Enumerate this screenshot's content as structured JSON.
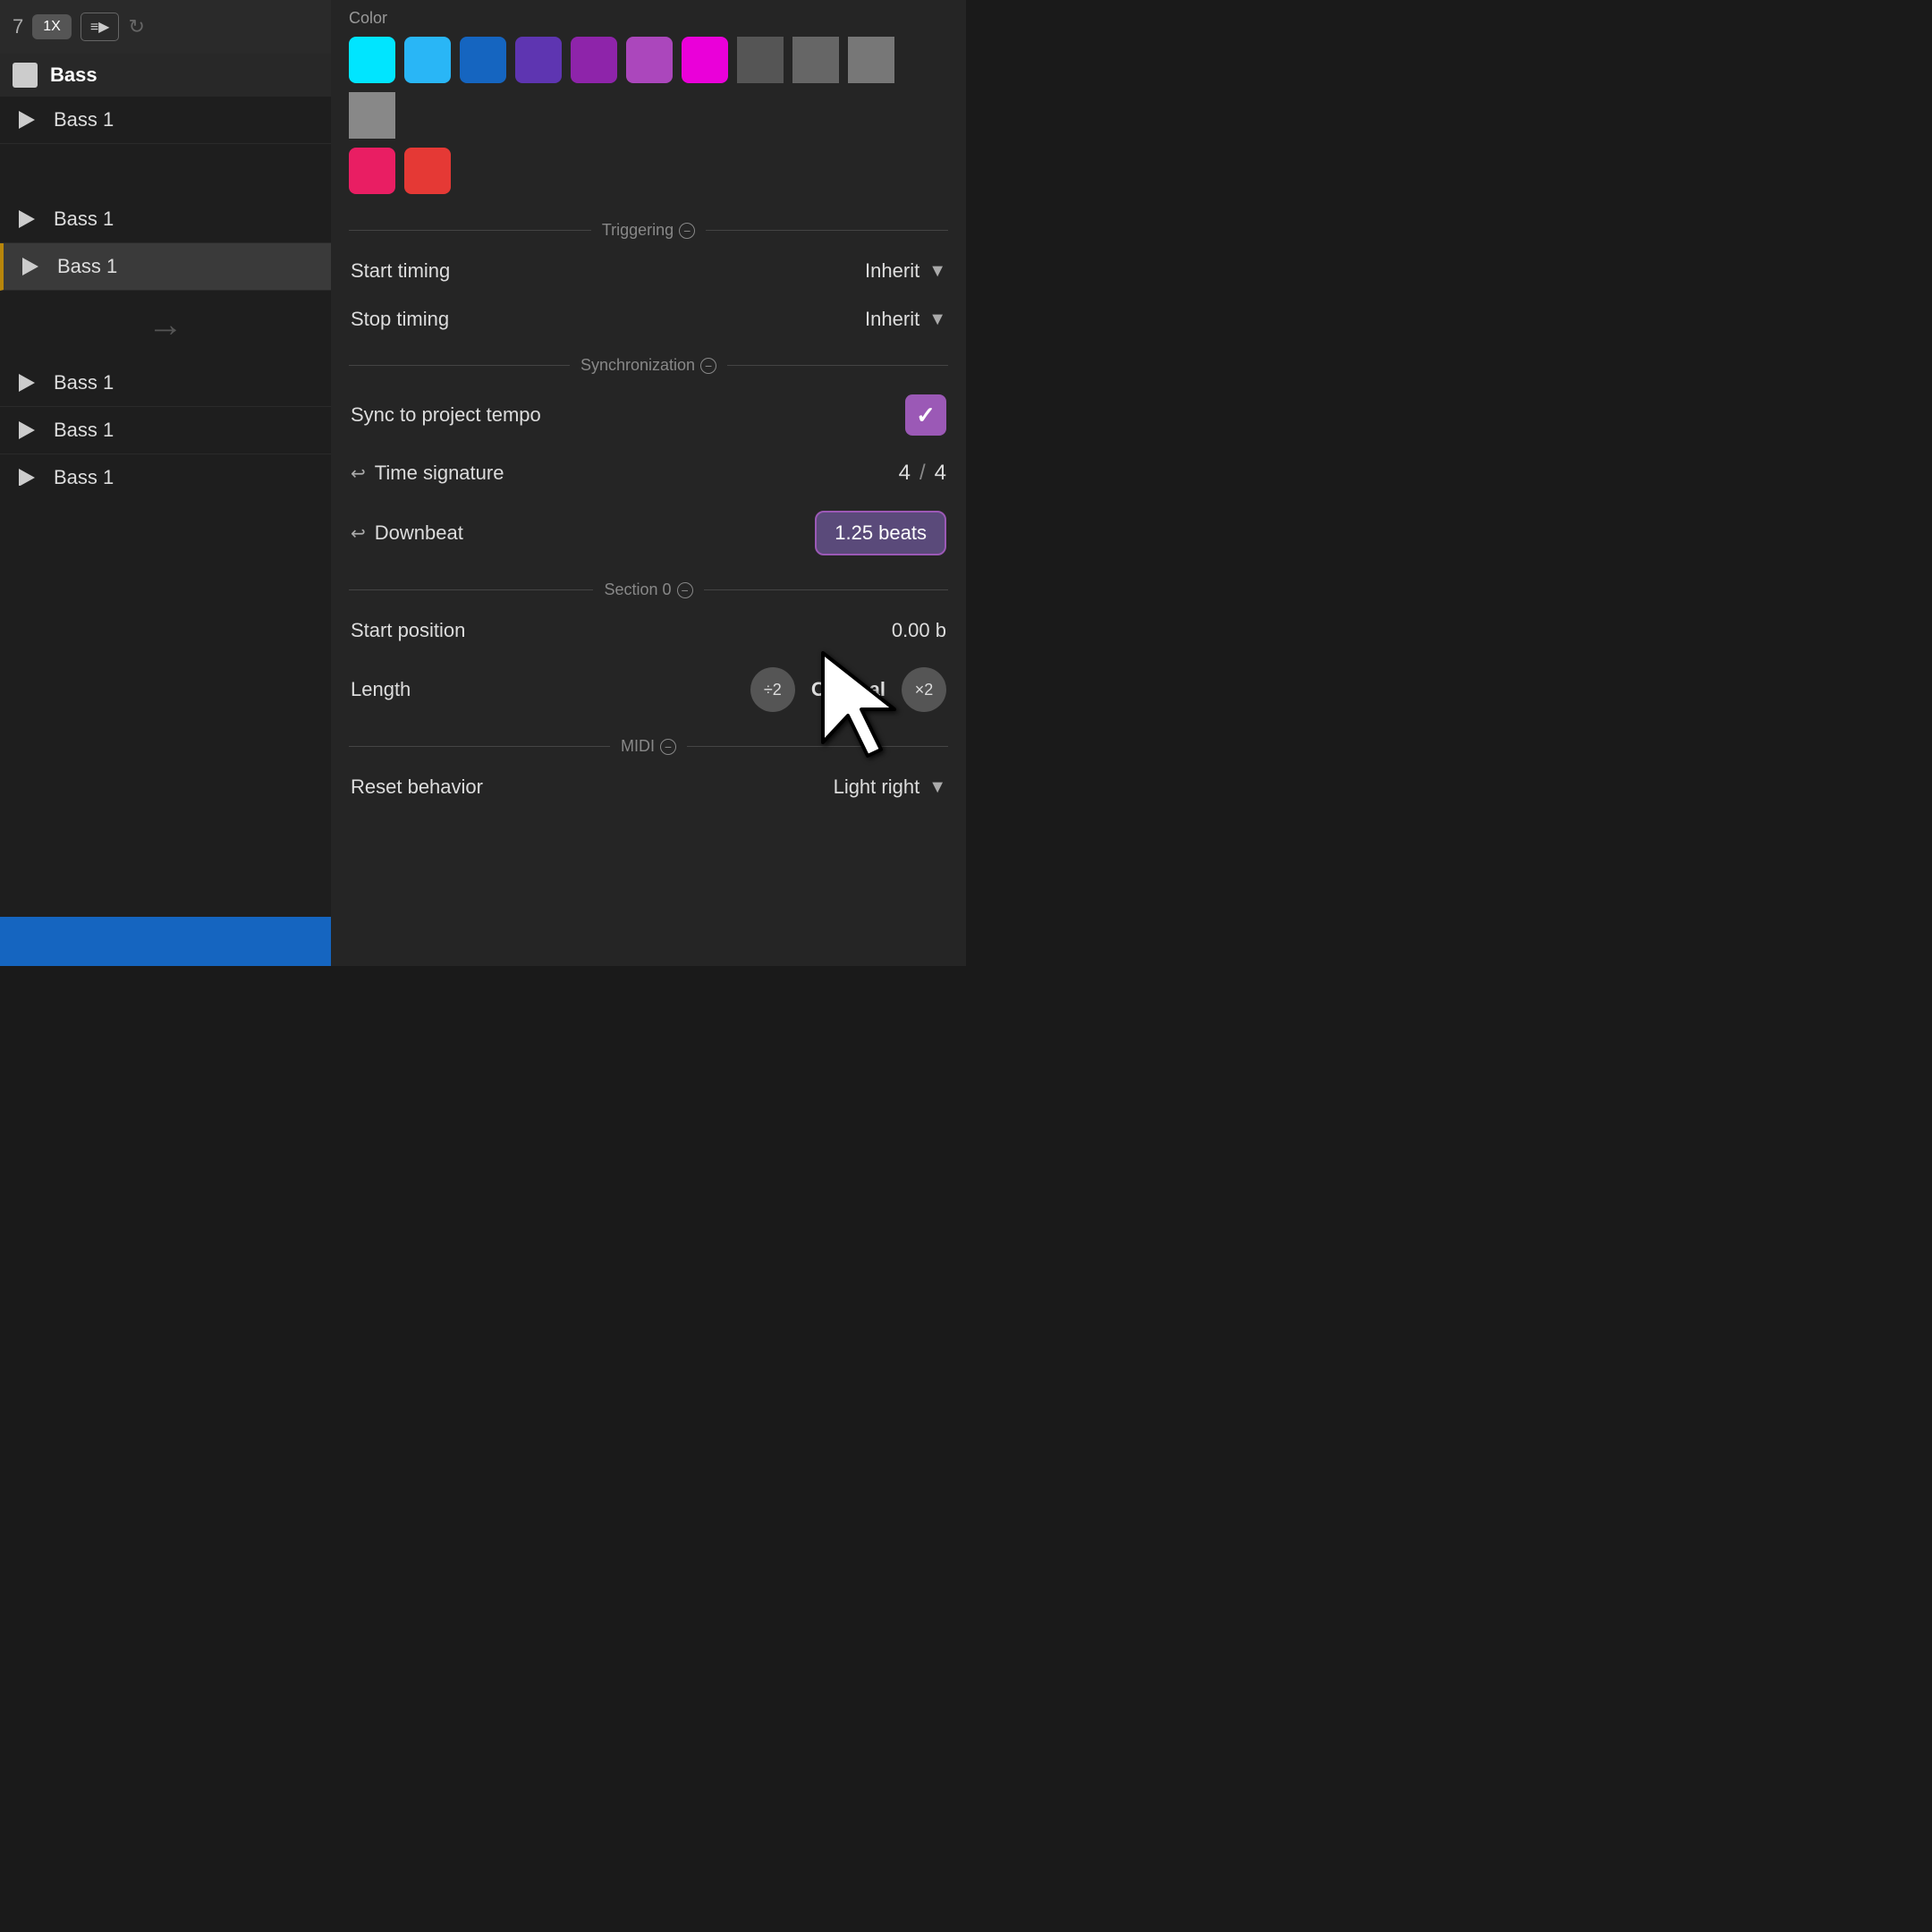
{
  "left_panel": {
    "top_bar": {
      "number": "7",
      "btn_1x": "1X",
      "btn_list": "≡▶",
      "btn_redo": "↻"
    },
    "tracks": [
      {
        "id": 0,
        "label": "Bass",
        "type": "group",
        "highlighted": false
      },
      {
        "id": 1,
        "label": "Bass 1",
        "type": "track",
        "highlighted": false
      },
      {
        "id": 2,
        "label": "Bass 1",
        "type": "track",
        "highlighted": false
      },
      {
        "id": 3,
        "label": "Bass 1",
        "type": "track",
        "highlighted": true
      },
      {
        "id": 4,
        "label": "Bass 1",
        "type": "track",
        "highlighted": false
      },
      {
        "id": 5,
        "label": "Bass 1",
        "type": "track",
        "highlighted": false
      },
      {
        "id": 6,
        "label": "Bass 1",
        "type": "track",
        "highlighted": false
      }
    ]
  },
  "right_panel": {
    "color_section": {
      "label": "Color",
      "swatches_row1": [
        "#00e5ff",
        "#29b6f6",
        "#1565c0",
        "#5e35b1",
        "#8e24aa",
        "#ab47bc",
        "#ea00d9"
      ],
      "swatches_row2": [
        "#e91e63",
        "#e53935"
      ],
      "gray_swatches": [
        "#555",
        "#666",
        "#777",
        "#888"
      ]
    },
    "triggering": {
      "section_label": "Triggering",
      "start_timing_label": "Start timing",
      "start_timing_value": "Inherit",
      "stop_timing_label": "Stop timing",
      "stop_timing_value": "Inherit"
    },
    "synchronization": {
      "section_label": "Synchronization",
      "sync_label": "Sync to project tempo",
      "sync_checked": true,
      "time_sig_label": "Time signature",
      "time_sig_num": "4",
      "time_sig_den": "4",
      "downbeat_label": "Downbeat",
      "downbeat_value": "1.25 beats"
    },
    "section_0": {
      "section_label": "Section 0",
      "start_position_label": "Start position",
      "start_position_value": "0.00 b",
      "length_label": "Length",
      "length_divide": "÷2",
      "length_value": "Original",
      "length_multiply": "×2"
    },
    "midi": {
      "section_label": "MIDI",
      "reset_behavior_label": "Reset behavior",
      "reset_behavior_value": "Light right"
    }
  }
}
